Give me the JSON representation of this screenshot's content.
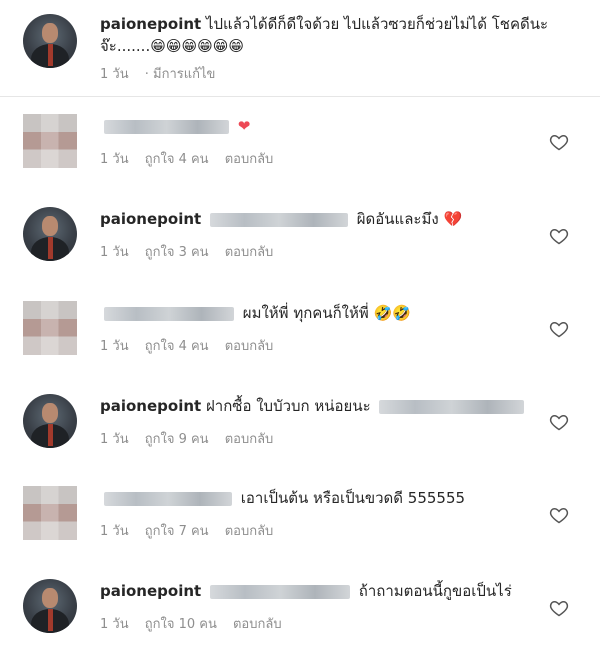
{
  "caption": {
    "username": "paionepoint",
    "text": "ไปแล้วได้ดีก็ดีใจด้วย  ไปแล้วซวยก็ช่วยไม่ได้  โชคดีนะจ๊ะ.......😁😁😁😁😁😁",
    "time": "1 วัน",
    "edited": "· มีการแก้ไข"
  },
  "comments": [
    {
      "username": "",
      "text": "",
      "emoji": "❤",
      "time": "1 วัน",
      "likes": "ถูกใจ 4 คน",
      "reply": "ตอบกลับ"
    },
    {
      "username": "paionepoint",
      "text": "ผิดอันและมึง",
      "emoji": "💔",
      "time": "1 วัน",
      "likes": "ถูกใจ 3 คน",
      "reply": "ตอบกลับ"
    },
    {
      "username": "",
      "text": "ผมให้พี่ ทุกคนก็ให้พี่",
      "emoji": "🤣🤣",
      "time": "1 วัน",
      "likes": "ถูกใจ 4 คน",
      "reply": "ตอบกลับ"
    },
    {
      "username": "paionepoint",
      "text": "ฝากซื้อ ใบบัวบก หน่อยนะ",
      "emoji": "",
      "time": "1 วัน",
      "likes": "ถูกใจ 9 คน",
      "reply": "ตอบกลับ"
    },
    {
      "username": "",
      "text": "เอาเป็นต้น หรือเป็นขวดดี 555555",
      "emoji": "",
      "time": "1 วัน",
      "likes": "ถูกใจ 7 คน",
      "reply": "ตอบกลับ"
    },
    {
      "username": "paionepoint",
      "text": "ถ้าถามตอนนี้กูขอเป็นไร่",
      "emoji": "",
      "time": "1 วัน",
      "likes": "ถูกใจ 10 คน",
      "reply": "ตอบกลับ"
    }
  ],
  "icons": {
    "like": "heart-outline-icon"
  },
  "colors": {
    "text": "#262626",
    "muted": "#8e8e8e",
    "divider": "#e6e6e6",
    "heart": "#ed4956"
  }
}
